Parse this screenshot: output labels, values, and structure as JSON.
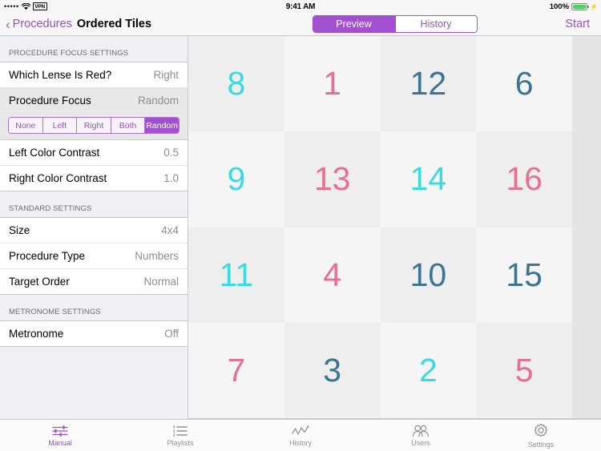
{
  "status_bar": {
    "signal_dots": "•••••",
    "wifi_icon": "wifi-icon",
    "vpn_badge": "VPN",
    "time": "9:41 AM",
    "battery_percent": "100%",
    "battery_icon": "battery-full-icon",
    "charging_icon": "lightning-bolt-icon"
  },
  "left_nav": {
    "back_chevron": "‹",
    "back_label": "Procedures",
    "title": "Ordered Tiles"
  },
  "right_nav": {
    "segments": [
      {
        "label": "Preview",
        "selected": true
      },
      {
        "label": "History",
        "selected": false
      }
    ],
    "start_label": "Start"
  },
  "sidebar": {
    "sections": [
      {
        "header": "PROCEDURE FOCUS SETTINGS",
        "rows": [
          {
            "title": "Which Lense Is Red?",
            "value": "Right",
            "style": "white"
          },
          {
            "title": "Procedure Focus",
            "value": "Random",
            "style": "grey"
          }
        ],
        "segmented": {
          "options": [
            "None",
            "Left",
            "Right",
            "Both",
            "Random"
          ],
          "selected": "Random"
        },
        "rows2": [
          {
            "title": "Left Color Contrast",
            "value": "0.5",
            "style": "white"
          },
          {
            "title": "Right Color Contrast",
            "value": "1.0",
            "style": "white"
          }
        ]
      },
      {
        "header": "STANDARD SETTINGS",
        "rows": [
          {
            "title": "Size",
            "value": "4x4",
            "style": "white"
          },
          {
            "title": "Procedure Type",
            "value": "Numbers",
            "style": "white"
          },
          {
            "title": "Target Order",
            "value": "Normal",
            "style": "white"
          }
        ]
      },
      {
        "header": "METRONOME SETTINGS",
        "rows": [
          {
            "title": "Metronome",
            "value": "Off",
            "style": "white"
          }
        ]
      }
    ]
  },
  "tile_grid": {
    "rows": 4,
    "cols": 4,
    "colors": {
      "cyan": "#3adbe0",
      "pink": "#e8708f",
      "steel_blue": "#3d7491"
    },
    "backgrounds": {
      "light": "#f5f5f5",
      "dark": "#eeeeee"
    },
    "tiles": [
      {
        "number": "8",
        "color": "#3adbe0",
        "bg": "#eeeeee"
      },
      {
        "number": "1",
        "color": "#e8708f",
        "bg": "#f5f5f5"
      },
      {
        "number": "12",
        "color": "#3d7491",
        "bg": "#eeeeee"
      },
      {
        "number": "6",
        "color": "#3d7491",
        "bg": "#f5f5f5"
      },
      {
        "number": "9",
        "color": "#3adbe0",
        "bg": "#f5f5f5"
      },
      {
        "number": "13",
        "color": "#e8708f",
        "bg": "#eeeeee"
      },
      {
        "number": "14",
        "color": "#3adbe0",
        "bg": "#f5f5f5"
      },
      {
        "number": "16",
        "color": "#e8708f",
        "bg": "#eeeeee"
      },
      {
        "number": "11",
        "color": "#3adbe0",
        "bg": "#eeeeee"
      },
      {
        "number": "4",
        "color": "#e8708f",
        "bg": "#f5f5f5"
      },
      {
        "number": "10",
        "color": "#3d7491",
        "bg": "#eeeeee"
      },
      {
        "number": "15",
        "color": "#3d7491",
        "bg": "#f5f5f5"
      },
      {
        "number": "7",
        "color": "#e8708f",
        "bg": "#f5f5f5"
      },
      {
        "number": "3",
        "color": "#3d7491",
        "bg": "#eeeeee"
      },
      {
        "number": "2",
        "color": "#3adbe0",
        "bg": "#f5f5f5"
      },
      {
        "number": "5",
        "color": "#e8708f",
        "bg": "#eeeeee"
      }
    ]
  },
  "tab_bar": {
    "items": [
      {
        "label": "Manual",
        "icon": "sliders-icon",
        "active": true
      },
      {
        "label": "Playlists",
        "icon": "list-icon",
        "active": false
      },
      {
        "label": "History",
        "icon": "chart-line-icon",
        "active": false
      },
      {
        "label": "Users",
        "icon": "users-icon",
        "active": false
      },
      {
        "label": "Settings",
        "icon": "gear-icon",
        "active": false
      }
    ],
    "active_color": "#9b4fc8",
    "inactive_color": "#929292"
  }
}
